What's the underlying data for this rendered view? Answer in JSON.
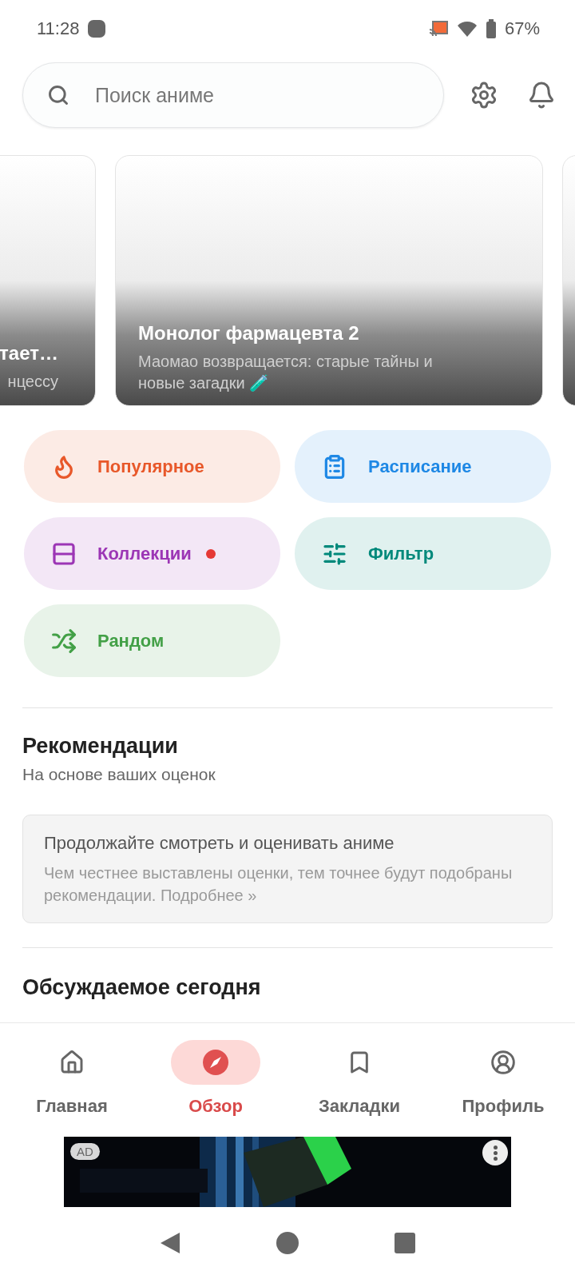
{
  "status_bar": {
    "time": "11:28",
    "battery": "67%"
  },
  "search": {
    "placeholder": "Поиск аниме"
  },
  "carousel": [
    {
      "title": "тает…",
      "subtitle": "нцессу",
      "kind": "partial"
    },
    {
      "title": "Монолог фармацевта 2",
      "subtitle": "Маомао возвращается: старые тайны и новые загадки 🧪",
      "kind": "full"
    },
    {
      "kind": "edge"
    }
  ],
  "shortcuts": [
    {
      "label": "Популярное",
      "color": "#e8582a",
      "badge": false
    },
    {
      "label": "Расписание",
      "color": "#1e88e5",
      "badge": false
    },
    {
      "label": "Коллекции",
      "color": "#9c36b5",
      "badge": true
    },
    {
      "label": "Фильтр",
      "color": "#00897b",
      "badge": false
    },
    {
      "label": "Рандом",
      "color": "#43a047",
      "badge": false
    }
  ],
  "recommendations": {
    "title": "Рекомендации",
    "subtitle": "На основе ваших оценок",
    "notice_title": "Продолжайте смотреть и оценивать аниме",
    "notice_text": "Чем честнее выставлены оценки, тем точнее будут подобраны рекомендации. Подробнее »"
  },
  "discussed": {
    "title": "Обсуждаемое сегодня"
  },
  "bottom_nav": [
    {
      "label": "Главная",
      "selected": false
    },
    {
      "label": "Обзор",
      "selected": true
    },
    {
      "label": "Закладки",
      "selected": false
    },
    {
      "label": "Профиль",
      "selected": false
    }
  ],
  "ad": {
    "badge": "AD",
    "kind": "picture"
  }
}
